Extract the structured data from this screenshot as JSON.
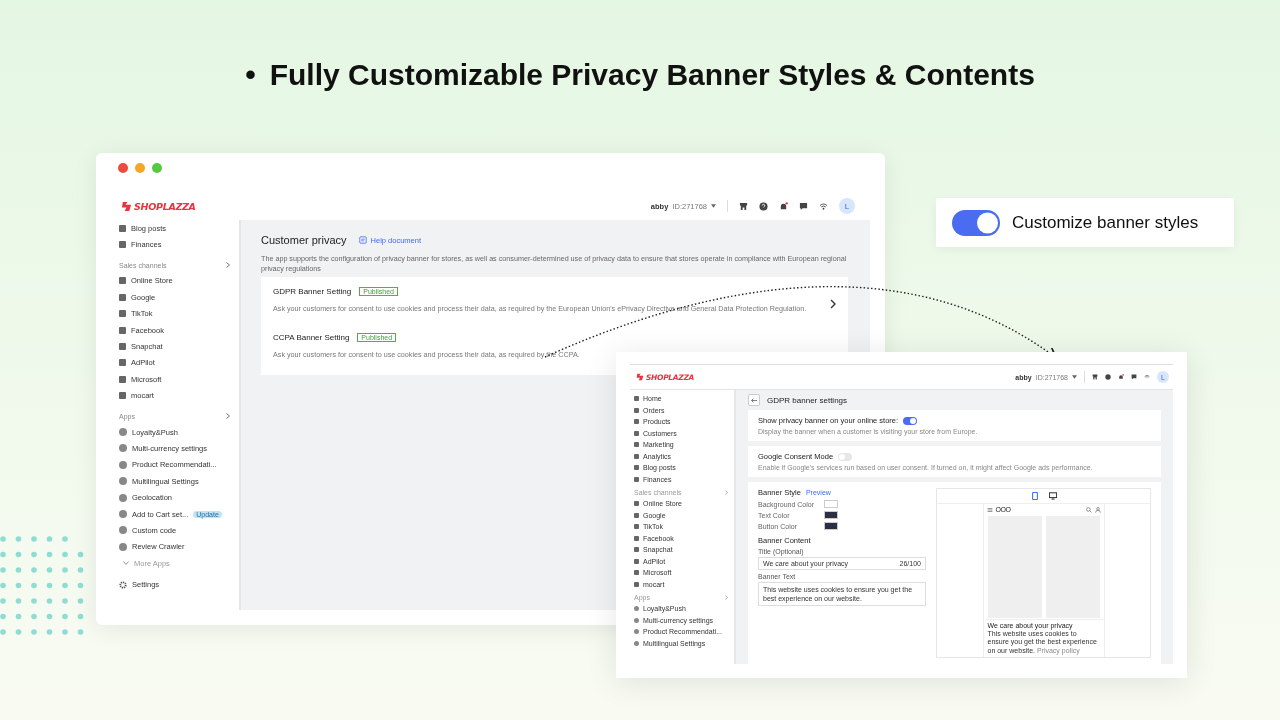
{
  "headline": {
    "bullet": "•",
    "text": "Fully Customizable Privacy Banner Styles & Contents"
  },
  "feature_toggle": {
    "label": "Customize banner styles",
    "on": true
  },
  "main_window": {
    "logo": "SHOPLAZZA",
    "account": {
      "name": "abby",
      "id": "ID:271768"
    },
    "avatar": "L",
    "sidebar": {
      "items": [
        {
          "label": "Blog posts"
        },
        {
          "label": "Finances"
        }
      ],
      "sections": [
        {
          "title": "Sales channels",
          "items": [
            {
              "label": "Online Store"
            },
            {
              "label": "Google"
            },
            {
              "label": "TikTok"
            },
            {
              "label": "Facebook"
            },
            {
              "label": "Snapchat"
            },
            {
              "label": "AdPilot"
            },
            {
              "label": "Microsoft"
            },
            {
              "label": "mocart"
            }
          ]
        },
        {
          "title": "Apps",
          "items": [
            {
              "label": "Loyalty&Push"
            },
            {
              "label": "Multi-currency settings"
            },
            {
              "label": "Product Recommendati..."
            },
            {
              "label": "Multilingual Settings"
            },
            {
              "label": "Geolocation"
            },
            {
              "label": "Add to Cart set...",
              "badge": "Update"
            },
            {
              "label": "Custom code"
            },
            {
              "label": "Review Crawler"
            }
          ]
        }
      ],
      "more": "More Apps",
      "settings": "Settings"
    },
    "page": {
      "title": "Customer privacy",
      "help": "Help document",
      "description": "The app supports the configuration of privacy banner for stores, as well as consumer-determined use of privacy data to ensure that stores operate in compliance with European regional privacy regulations",
      "banners": [
        {
          "title": "GDPR Banner Setting",
          "status": "Published",
          "description": "Ask your customers for consent to use cookies and process their data, as required by the European Union's ePrivacy Directive and General Data Protection Regulation.",
          "chevron": true
        },
        {
          "title": "CCPA Banner Setting",
          "status": "Published",
          "description": "Ask your customers for consent to use cookies and process their data, as required by the CCPA.",
          "chevron": false
        }
      ]
    }
  },
  "detail_window": {
    "logo": "SHOPLAZZA",
    "account": {
      "name": "abby",
      "id": "ID:271768"
    },
    "avatar": "L",
    "sidebar": {
      "items": [
        {
          "label": "Home"
        },
        {
          "label": "Orders"
        },
        {
          "label": "Products"
        },
        {
          "label": "Customers"
        },
        {
          "label": "Marketing"
        },
        {
          "label": "Analytics"
        },
        {
          "label": "Blog posts"
        },
        {
          "label": "Finances"
        }
      ],
      "sections": [
        {
          "title": "Sales channels",
          "items": [
            {
              "label": "Online Store"
            },
            {
              "label": "Google"
            },
            {
              "label": "TikTok"
            },
            {
              "label": "Facebook"
            },
            {
              "label": "Snapchat"
            },
            {
              "label": "AdPilot"
            },
            {
              "label": "Microsoft"
            },
            {
              "label": "mocart"
            }
          ]
        },
        {
          "title": "Apps",
          "items": [
            {
              "label": "Loyalty&Push"
            },
            {
              "label": "Multi-currency settings"
            },
            {
              "label": "Product Recommendati..."
            },
            {
              "label": "Multilingual Settings"
            }
          ]
        }
      ]
    },
    "page": {
      "title": "GDPR banner settings",
      "settings": [
        {
          "label": "Show privacy banner on your online store:",
          "on": true,
          "description": "Display the banner when a customer is visiting your store from Europe."
        },
        {
          "label": "Google Consent Mode",
          "on": false,
          "description": "Enable if Google's services run based on user consent. If turned on, it might affect Google ads performance."
        }
      ],
      "style": {
        "title": "Banner Style",
        "preview": "Preview",
        "colors": [
          {
            "label": "Background Color",
            "color": "#ffffff"
          },
          {
            "label": "Text Color",
            "color": "#2b2e45"
          },
          {
            "label": "Button Color",
            "color": "#2b2e45"
          }
        ]
      },
      "content": {
        "title": "Banner Content",
        "title_label": "Title (Optional)",
        "title_value": "We care about your privacy",
        "title_count": "26/100",
        "text_label": "Banner Text",
        "text_value": "This website uses cookies to ensure you get the best experience on our website."
      },
      "preview": {
        "devices": [
          {
            "kind": "mobile",
            "selected": true
          },
          {
            "kind": "desktop",
            "selected": false
          }
        ],
        "store_logo": "OOO",
        "banner_title": "We care about your privacy",
        "banner_text": "This website uses cookies to ensure you get the best experience on our website.",
        "link": "Privacy policy"
      }
    }
  }
}
